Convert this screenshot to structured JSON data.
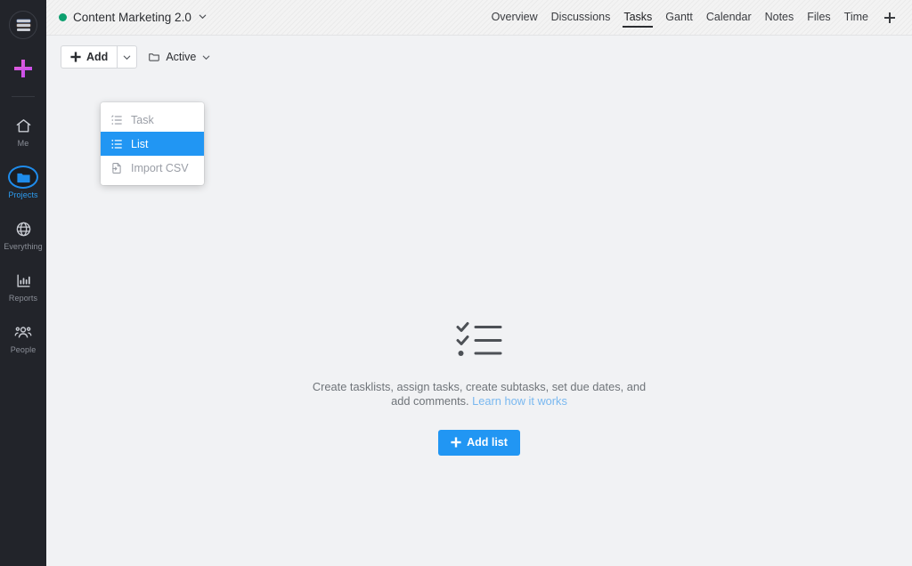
{
  "rail": {
    "menu_icon": "hamburger-icon",
    "add_icon": "plus-icon",
    "items": [
      {
        "label": "Me",
        "icon": "home-icon",
        "active": false
      },
      {
        "label": "Projects",
        "icon": "folder-icon",
        "active": true
      },
      {
        "label": "Everything",
        "icon": "globe-icon",
        "active": false
      },
      {
        "label": "Reports",
        "icon": "bar-chart-icon",
        "active": false
      },
      {
        "label": "People",
        "icon": "people-icon",
        "active": false
      }
    ]
  },
  "topbar": {
    "project_name": "Content Marketing 2.0",
    "status_color": "#0c9f6e",
    "chevron": "⌄",
    "tabs": [
      {
        "label": "Overview",
        "active": false
      },
      {
        "label": "Discussions",
        "active": false
      },
      {
        "label": "Tasks",
        "active": true
      },
      {
        "label": "Gantt",
        "active": false
      },
      {
        "label": "Calendar",
        "active": false
      },
      {
        "label": "Notes",
        "active": false
      },
      {
        "label": "Files",
        "active": false
      },
      {
        "label": "Time",
        "active": false
      }
    ],
    "add_tab_icon": "plus-icon"
  },
  "toolbar": {
    "add_label": "Add",
    "add_icon": "plus-icon",
    "add_caret_icon": "chevron-down-icon",
    "filter_label": "Active",
    "filter_icon": "folder-icon",
    "filter_caret_icon": "chevron-down-icon"
  },
  "dropdown": {
    "items": [
      {
        "label": "Task",
        "icon": "task-list-icon",
        "selected": false
      },
      {
        "label": "List",
        "icon": "bullet-list-icon",
        "selected": true
      },
      {
        "label": "Import CSV",
        "icon": "import-file-icon",
        "selected": false
      }
    ],
    "highlight_color": "#2196f3"
  },
  "empty_state": {
    "icon": "checklist-icon",
    "description": "Create tasklists, assign tasks, create subtasks, set due dates, and add comments. ",
    "link_text": "Learn how it works",
    "button_label": "Add list",
    "button_icon": "plus-icon",
    "button_color": "#2196f3"
  }
}
